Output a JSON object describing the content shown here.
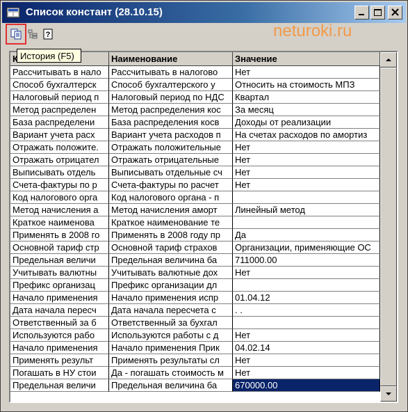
{
  "window": {
    "title": "Список констант (28.10.15)",
    "controls": [
      "minimize",
      "maximize",
      "close"
    ]
  },
  "toolbar": {
    "buttons": [
      {
        "icon": "history-icon",
        "tooltip": "История (F5)",
        "active": true
      },
      {
        "icon": "tree-icon"
      },
      {
        "icon": "help-icon"
      }
    ],
    "tooltip_text": "История (F5)"
  },
  "watermark": "neturoki.ru",
  "table": {
    "columns": [
      "К",
      "Наименование",
      "Значение"
    ],
    "rows": [
      [
        "Рассчитывать в нало",
        "Рассчитывать в налогово",
        "Нет"
      ],
      [
        "Способ бухгалтерск",
        "Способ бухгалтерского у",
        "Относить на стоимость МПЗ"
      ],
      [
        "Налоговый период п",
        "Налоговый период по НДС",
        "Квартал"
      ],
      [
        "Метод распределен",
        "Метод распределения кос",
        "За месяц"
      ],
      [
        "База распределени",
        "База распределения косв",
        "Доходы от реализации"
      ],
      [
        "Вариант учета расх",
        "Вариант учета расходов п",
        "На счетах расходов по амортиз"
      ],
      [
        "Отражать положите.",
        "Отражать положительные",
        "Нет"
      ],
      [
        "Отражать отрицател",
        "Отражать отрицательные",
        "Нет"
      ],
      [
        "Выписывать отдель",
        "Выписывать отдельные сч",
        "Нет"
      ],
      [
        "Счета-фактуры по р",
        "Счета-фактуры по расчет",
        "Нет"
      ],
      [
        "Код налогового орга",
        "Код налогового органа - п",
        ""
      ],
      [
        "Метод начисления а",
        "Метод начисления аморт",
        "Линейный метод"
      ],
      [
        "Краткое наименова",
        "Краткое наименование те",
        ""
      ],
      [
        "Применять в 2008 го",
        "Применять в 2008 году пр",
        "Да"
      ],
      [
        "Основной тариф стр",
        "Основной тариф страхов",
        "Организации, применяющие ОС"
      ],
      [
        "Предельная величи",
        "Предельная величина ба",
        "711000.00"
      ],
      [
        "Учитывать валютны",
        "Учитывать валютные дох",
        "Нет"
      ],
      [
        "Префикс организац",
        "Префикс организации дл",
        ""
      ],
      [
        "Начало применения",
        "Начало применения испр",
        "01.04.12"
      ],
      [
        "Дата начала пересч",
        "Дата начала пересчета с",
        " .  ."
      ],
      [
        "Ответственный за б",
        "Ответственный за бухгал",
        ""
      ],
      [
        "Используются рабо",
        "Используются работы с д",
        "Нет"
      ],
      [
        "Начало применения",
        "Начало применения Прик",
        "04.02.14"
      ],
      [
        "Применять результ",
        "Применять результаты сл",
        "Нет"
      ],
      [
        "Погашать в НУ стои",
        "Да - погашать стоимость м",
        "Нет"
      ],
      [
        "Предельная величи",
        "Предельная величина ба",
        "670000.00"
      ]
    ],
    "selected_row": 25
  },
  "colors": {
    "title_bar": "#0a246a",
    "selection": "#0a246a",
    "watermark": "#f29a4a",
    "tooltip_bg": "#ffffe1"
  }
}
